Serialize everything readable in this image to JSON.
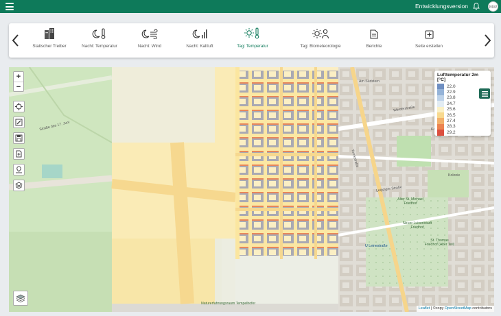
{
  "header": {
    "version_label": "Entwicklungsversion",
    "avatar_initials": "MW"
  },
  "toolbar": {
    "items": [
      {
        "label": "Statischer Treiber",
        "icon": "buildings-icon"
      },
      {
        "label": "Nacht: Temperatur",
        "icon": "moon-thermometer-icon"
      },
      {
        "label": "Nacht: Wind",
        "icon": "moon-wind-icon"
      },
      {
        "label": "Nacht: Kaltluft",
        "icon": "moon-bars-icon"
      },
      {
        "label": "Tag: Temperatur",
        "icon": "sun-thermometer-icon",
        "active": true
      },
      {
        "label": "Tag: Biometeorologie",
        "icon": "sun-person-icon"
      },
      {
        "label": "Berichte",
        "icon": "document-icon"
      },
      {
        "label": "Seite erstellen",
        "icon": "add-page-icon"
      }
    ]
  },
  "legend": {
    "title": "Lufttemperatur 2m [°C]",
    "entries": [
      {
        "value": "22.0",
        "color": "#6f8fc2"
      },
      {
        "value": "22.9",
        "color": "#95b3d8"
      },
      {
        "value": "23.8",
        "color": "#bdd2e9"
      },
      {
        "value": "24.7",
        "color": "#e2ecf3"
      },
      {
        "value": "25.6",
        "color": "#fbf1c6"
      },
      {
        "value": "26.5",
        "color": "#f8d98f"
      },
      {
        "value": "27.4",
        "color": "#f3b06a"
      },
      {
        "value": "28.3",
        "color": "#ec8450"
      },
      {
        "value": "29.2",
        "color": "#dc4f3f"
      }
    ]
  },
  "map": {
    "labels": {
      "street_1": "Straße des 17. Juni",
      "street_2": "Werderstraße",
      "street_3": "Leipziger Straße",
      "street_4": "Yorckstraße",
      "street_5": "Kolonie",
      "station": "U Leinestraße",
      "park_1": "Alter St. Michael Friedhof",
      "park_2": "Neuer Luisenstadt Friedhof",
      "park_3": "St. Thomas Friedhof (Alter Teil)",
      "park_4": "Naturerfahrungsraum Tempelhofer",
      "street_6": "Am Südstern",
      "kolonie": "Kolonie"
    },
    "attribution": {
      "leaflet": "Leaflet",
      "sep": " | ©copy ",
      "osm": "OpenStreetMap",
      "suffix": " contributors"
    }
  }
}
